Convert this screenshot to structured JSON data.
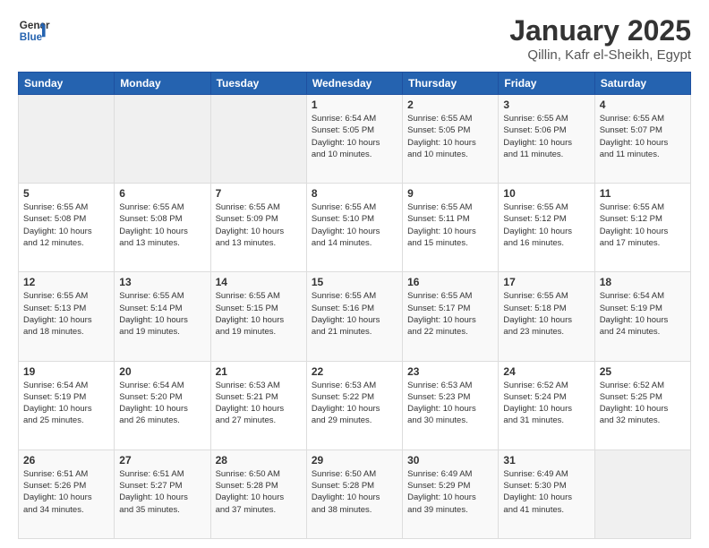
{
  "header": {
    "logo_line1": "General",
    "logo_line2": "Blue",
    "title": "January 2025",
    "subtitle": "Qillin, Kafr el-Sheikh, Egypt"
  },
  "calendar": {
    "days_of_week": [
      "Sunday",
      "Monday",
      "Tuesday",
      "Wednesday",
      "Thursday",
      "Friday",
      "Saturday"
    ],
    "weeks": [
      [
        {
          "day": "",
          "info": ""
        },
        {
          "day": "",
          "info": ""
        },
        {
          "day": "",
          "info": ""
        },
        {
          "day": "1",
          "info": "Sunrise: 6:54 AM\nSunset: 5:05 PM\nDaylight: 10 hours\nand 10 minutes."
        },
        {
          "day": "2",
          "info": "Sunrise: 6:55 AM\nSunset: 5:05 PM\nDaylight: 10 hours\nand 10 minutes."
        },
        {
          "day": "3",
          "info": "Sunrise: 6:55 AM\nSunset: 5:06 PM\nDaylight: 10 hours\nand 11 minutes."
        },
        {
          "day": "4",
          "info": "Sunrise: 6:55 AM\nSunset: 5:07 PM\nDaylight: 10 hours\nand 11 minutes."
        }
      ],
      [
        {
          "day": "5",
          "info": "Sunrise: 6:55 AM\nSunset: 5:08 PM\nDaylight: 10 hours\nand 12 minutes."
        },
        {
          "day": "6",
          "info": "Sunrise: 6:55 AM\nSunset: 5:08 PM\nDaylight: 10 hours\nand 13 minutes."
        },
        {
          "day": "7",
          "info": "Sunrise: 6:55 AM\nSunset: 5:09 PM\nDaylight: 10 hours\nand 13 minutes."
        },
        {
          "day": "8",
          "info": "Sunrise: 6:55 AM\nSunset: 5:10 PM\nDaylight: 10 hours\nand 14 minutes."
        },
        {
          "day": "9",
          "info": "Sunrise: 6:55 AM\nSunset: 5:11 PM\nDaylight: 10 hours\nand 15 minutes."
        },
        {
          "day": "10",
          "info": "Sunrise: 6:55 AM\nSunset: 5:12 PM\nDaylight: 10 hours\nand 16 minutes."
        },
        {
          "day": "11",
          "info": "Sunrise: 6:55 AM\nSunset: 5:12 PM\nDaylight: 10 hours\nand 17 minutes."
        }
      ],
      [
        {
          "day": "12",
          "info": "Sunrise: 6:55 AM\nSunset: 5:13 PM\nDaylight: 10 hours\nand 18 minutes."
        },
        {
          "day": "13",
          "info": "Sunrise: 6:55 AM\nSunset: 5:14 PM\nDaylight: 10 hours\nand 19 minutes."
        },
        {
          "day": "14",
          "info": "Sunrise: 6:55 AM\nSunset: 5:15 PM\nDaylight: 10 hours\nand 19 minutes."
        },
        {
          "day": "15",
          "info": "Sunrise: 6:55 AM\nSunset: 5:16 PM\nDaylight: 10 hours\nand 21 minutes."
        },
        {
          "day": "16",
          "info": "Sunrise: 6:55 AM\nSunset: 5:17 PM\nDaylight: 10 hours\nand 22 minutes."
        },
        {
          "day": "17",
          "info": "Sunrise: 6:55 AM\nSunset: 5:18 PM\nDaylight: 10 hours\nand 23 minutes."
        },
        {
          "day": "18",
          "info": "Sunrise: 6:54 AM\nSunset: 5:19 PM\nDaylight: 10 hours\nand 24 minutes."
        }
      ],
      [
        {
          "day": "19",
          "info": "Sunrise: 6:54 AM\nSunset: 5:19 PM\nDaylight: 10 hours\nand 25 minutes."
        },
        {
          "day": "20",
          "info": "Sunrise: 6:54 AM\nSunset: 5:20 PM\nDaylight: 10 hours\nand 26 minutes."
        },
        {
          "day": "21",
          "info": "Sunrise: 6:53 AM\nSunset: 5:21 PM\nDaylight: 10 hours\nand 27 minutes."
        },
        {
          "day": "22",
          "info": "Sunrise: 6:53 AM\nSunset: 5:22 PM\nDaylight: 10 hours\nand 29 minutes."
        },
        {
          "day": "23",
          "info": "Sunrise: 6:53 AM\nSunset: 5:23 PM\nDaylight: 10 hours\nand 30 minutes."
        },
        {
          "day": "24",
          "info": "Sunrise: 6:52 AM\nSunset: 5:24 PM\nDaylight: 10 hours\nand 31 minutes."
        },
        {
          "day": "25",
          "info": "Sunrise: 6:52 AM\nSunset: 5:25 PM\nDaylight: 10 hours\nand 32 minutes."
        }
      ],
      [
        {
          "day": "26",
          "info": "Sunrise: 6:51 AM\nSunset: 5:26 PM\nDaylight: 10 hours\nand 34 minutes."
        },
        {
          "day": "27",
          "info": "Sunrise: 6:51 AM\nSunset: 5:27 PM\nDaylight: 10 hours\nand 35 minutes."
        },
        {
          "day": "28",
          "info": "Sunrise: 6:50 AM\nSunset: 5:28 PM\nDaylight: 10 hours\nand 37 minutes."
        },
        {
          "day": "29",
          "info": "Sunrise: 6:50 AM\nSunset: 5:28 PM\nDaylight: 10 hours\nand 38 minutes."
        },
        {
          "day": "30",
          "info": "Sunrise: 6:49 AM\nSunset: 5:29 PM\nDaylight: 10 hours\nand 39 minutes."
        },
        {
          "day": "31",
          "info": "Sunrise: 6:49 AM\nSunset: 5:30 PM\nDaylight: 10 hours\nand 41 minutes."
        },
        {
          "day": "",
          "info": ""
        }
      ]
    ]
  }
}
